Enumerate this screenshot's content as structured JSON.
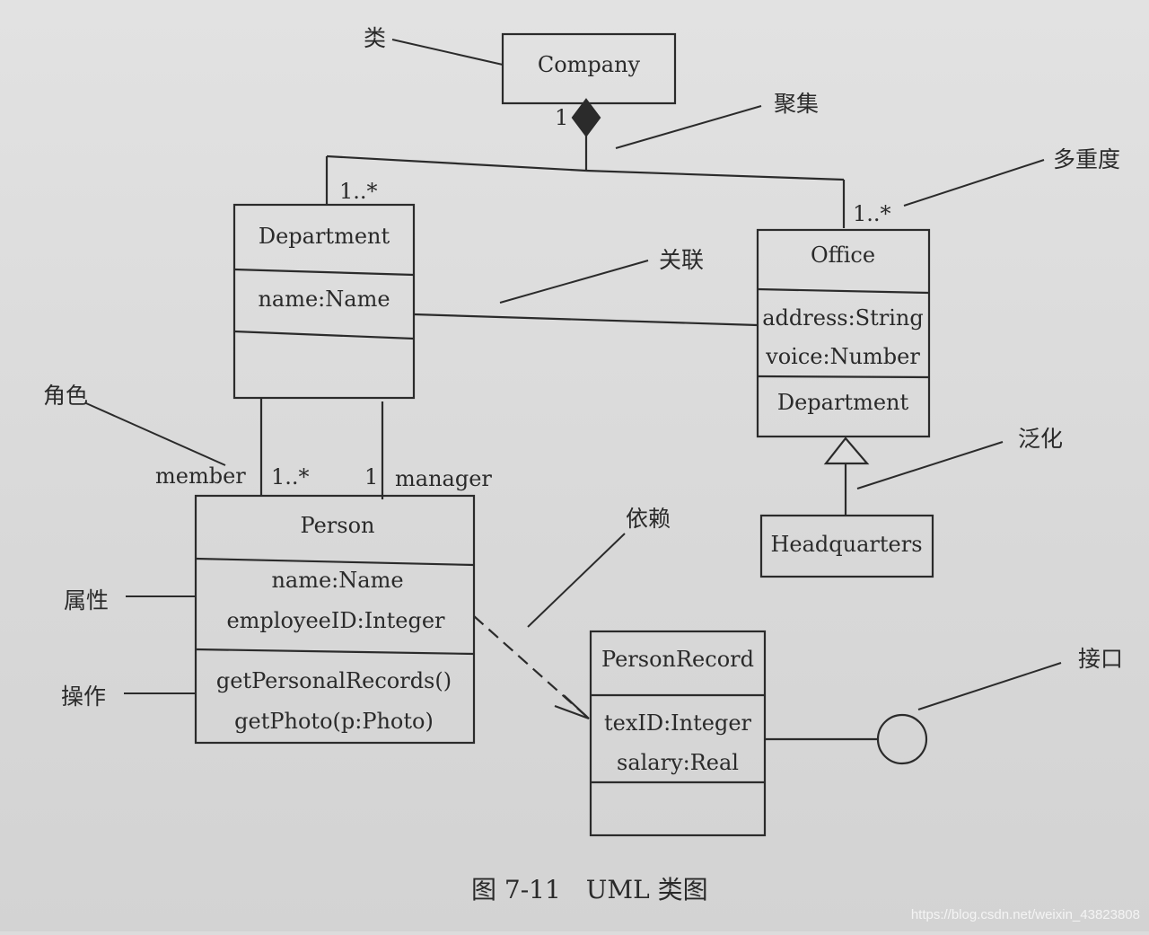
{
  "classes": {
    "company": {
      "name": "Company"
    },
    "department": {
      "name": "Department",
      "attributes": [
        "name:Name"
      ]
    },
    "office": {
      "name": "Office",
      "attributes": [
        "address:String",
        "voice:Number"
      ],
      "operations": [
        "Department"
      ]
    },
    "headquarters": {
      "name": "Headquarters"
    },
    "person": {
      "name": "Person",
      "attributes": [
        "name:Name",
        "employeeID:Integer"
      ],
      "operations": [
        "getPersonalRecords()",
        "getPhoto(p:Photo)"
      ]
    },
    "person_record": {
      "name": "PersonRecord",
      "attributes": [
        "texID:Integer",
        "salary:Real"
      ]
    }
  },
  "multiplicities": {
    "company_end": "1",
    "department_end": "1..*",
    "office_end": "1..*",
    "member_end": "1..*",
    "manager_end": "1"
  },
  "roles": {
    "member": "member",
    "manager": "manager"
  },
  "annotations": {
    "class": "类",
    "aggregation": "聚集",
    "multiplicity": "多重度",
    "association": "关联",
    "generalization": "泛化",
    "role": "角色",
    "dependency": "依赖",
    "attribute": "属性",
    "operation": "操作",
    "interface": "接口"
  },
  "caption": "图 7-11　UML 类图",
  "watermark": "https://blog.csdn.net/weixin_43823808"
}
